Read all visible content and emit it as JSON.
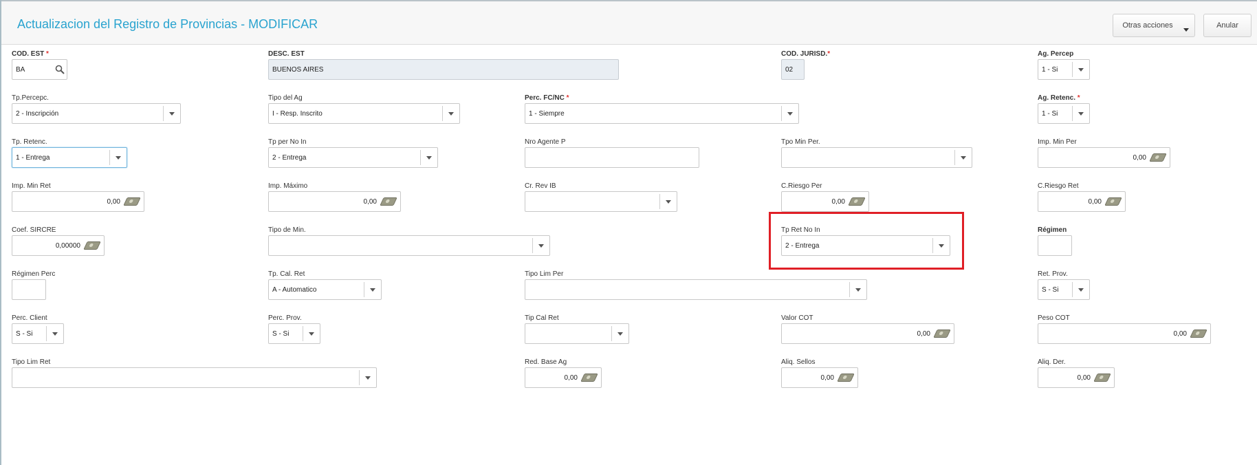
{
  "header": {
    "title": "Actualizacion del Registro de Provincias - MODIFICAR",
    "otras_label": "Otras acciones",
    "anular_label": "Anular"
  },
  "fields": {
    "cod_est": {
      "label": "COD. EST",
      "required": "*",
      "value": "BA"
    },
    "desc_est": {
      "label": "DESC. EST",
      "value": "BUENOS AIRES"
    },
    "cod_jurisd": {
      "label": "COD. JURISD.",
      "required": "*",
      "value": "02"
    },
    "ag_percep": {
      "label": "Ag. Percep",
      "value": "1 - Si"
    },
    "tp_percepc": {
      "label": "Tp.Percepc.",
      "value": "2 - Inscripción"
    },
    "tipo_del_ag": {
      "label": "Tipo del Ag",
      "value": "I - Resp. Inscrito"
    },
    "perc_fc_nc": {
      "label": "Perc. FC/NC",
      "required": "*",
      "value": "1 - Siempre"
    },
    "ag_retenc": {
      "label": "Ag. Retenc.",
      "required": "*",
      "value": "1 - Si"
    },
    "tp_retenc": {
      "label": "Tp. Retenc.",
      "value": "1 - Entrega"
    },
    "tp_per_no_in": {
      "label": "Tp per No In",
      "value": "2 - Entrega"
    },
    "nro_agente_p": {
      "label": "Nro Agente P",
      "value": ""
    },
    "tpo_min_per": {
      "label": "Tpo Min Per.",
      "value": ""
    },
    "imp_min_per": {
      "label": "Imp. Min Per",
      "value": "0,00"
    },
    "imp_min_ret": {
      "label": "Imp. Min Ret",
      "value": "0,00"
    },
    "imp_maximo": {
      "label": "Imp. Máximo",
      "value": "0,00"
    },
    "cr_rev_ib": {
      "label": "Cr. Rev IB",
      "value": ""
    },
    "c_riesgo_per": {
      "label": "C.Riesgo Per",
      "value": "0,00"
    },
    "c_riesgo_ret": {
      "label": "C.Riesgo Ret",
      "value": "0,00"
    },
    "coef_sircre": {
      "label": "Coef. SIRCRE",
      "value": "0,00000"
    },
    "tipo_de_min": {
      "label": "Tipo de Min.",
      "value": ""
    },
    "tp_ret_no_in": {
      "label": "Tp Ret No In",
      "value": "2 - Entrega"
    },
    "regimen": {
      "label": "Régimen",
      "value": ""
    },
    "regimen_perc": {
      "label": "Régimen Perc",
      "value": ""
    },
    "tp_cal_ret": {
      "label": "Tp. Cal. Ret",
      "value": "A - Automatico"
    },
    "tipo_lim_per": {
      "label": "Tipo Lim Per",
      "value": ""
    },
    "ret_prov": {
      "label": "Ret. Prov.",
      "value": "S - Si"
    },
    "perc_client": {
      "label": "Perc. Client",
      "value": "S - Si"
    },
    "perc_prov": {
      "label": "Perc. Prov.",
      "value": "S - Si"
    },
    "tip_cal_ret": {
      "label": "Tip Cal Ret",
      "value": ""
    },
    "valor_cot": {
      "label": "Valor COT",
      "value": "0,00"
    },
    "peso_cot": {
      "label": "Peso COT",
      "value": "0,00"
    },
    "tipo_lim_ret": {
      "label": "Tipo Lim Ret",
      "value": ""
    },
    "red_base_ag": {
      "label": "Red. Base Ag",
      "value": "0,00"
    },
    "aliq_sellos": {
      "label": "Aliq. Sellos",
      "value": "0,00"
    },
    "aliq_der": {
      "label": "Aliq. Der.",
      "value": "0,00"
    }
  },
  "colors": {
    "title": "#29a3cf",
    "required": "#e0322f",
    "highlight": "#e01f26"
  },
  "icons": {
    "cod_est_lookup": "search-icon",
    "numeric_fields": "money-icon",
    "selects": "chevron-down-icon"
  }
}
